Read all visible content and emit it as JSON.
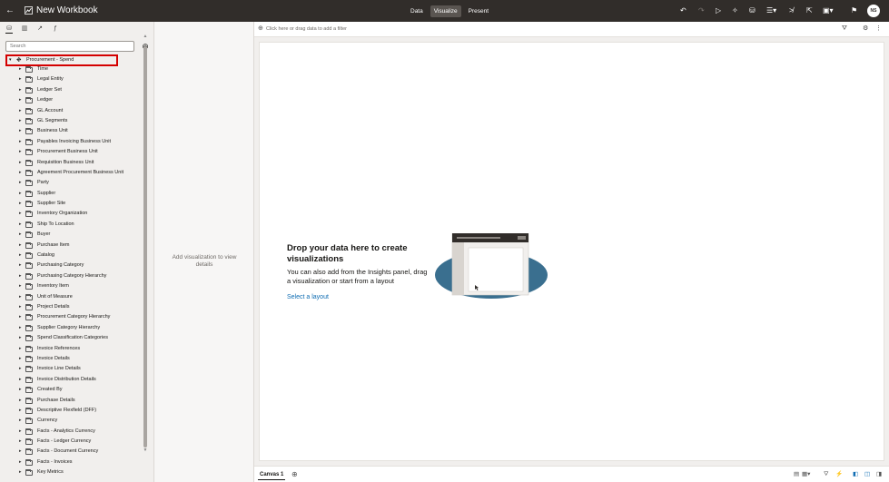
{
  "header": {
    "title": "New Workbook",
    "modes": [
      {
        "label": "Data",
        "active": false
      },
      {
        "label": "Visualize",
        "active": true
      },
      {
        "label": "Present",
        "active": false
      }
    ],
    "avatar_initials": "NS",
    "toolbar_icons": [
      "undo-icon",
      "redo-icon",
      "preview-icon",
      "auto-insights-icon",
      "data-refresh-icon",
      "presentation-menu-icon",
      "narrate-icon",
      "export-icon",
      "save-icon",
      "bookmark-icon"
    ]
  },
  "left_panel": {
    "tabs": [
      "data-icon",
      "visualizations-icon",
      "analytics-icon",
      "calculations-icon"
    ],
    "search_placeholder": "Search",
    "root": "Procurement - Spend",
    "items": [
      "Time",
      "Legal Entity",
      "Ledger Set",
      "Ledger",
      "GL Account",
      "GL Segments",
      "Business Unit",
      "Payables Invoicing Business Unit",
      "Procurement Business Unit",
      "Requisition Business Unit",
      "Agreement Procurement Business Unit",
      "Party",
      "Supplier",
      "Supplier Site",
      "Inventory Organization",
      "Ship To Location",
      "Buyer",
      "Purchase Item",
      "Catalog",
      "Purchasing Category",
      "Purchasing Category Hierarchy",
      "Inventory Item",
      "Unit of Measure",
      "Project Details",
      "Procurement Category Hierarchy",
      "Supplier Category Hierarchy",
      "Spend Classification Categories",
      "Invoice References",
      "Invoice Details",
      "Invoice Line Details",
      "Invoice Distribution Details",
      "Created By",
      "Purchase Details",
      "Descriptive Flexfield (DFF)",
      "Currency",
      "Facts - Analytics Currency",
      "Facts - Ledger Currency",
      "Facts - Document Currency",
      "Facts - Invoices",
      "Key Metrics"
    ]
  },
  "grammar": {
    "hint": "Add visualization to view details"
  },
  "filter_bar": {
    "placeholder": "Click here or drag data to add a filter"
  },
  "canvas": {
    "drop_title": "Drop your data here to create visualizations",
    "drop_body": "You can also add from the Insights panel, drag a visualization or start from a layout",
    "layout_link": "Select a layout"
  },
  "bottom": {
    "canvas_tab": "Canvas 1"
  },
  "colors": {
    "header_bg": "#312d2a",
    "panel_bg": "#f1efed",
    "link": "#0f6db3",
    "highlight": "#d40000",
    "accent_blue": "#3a6f8f"
  }
}
